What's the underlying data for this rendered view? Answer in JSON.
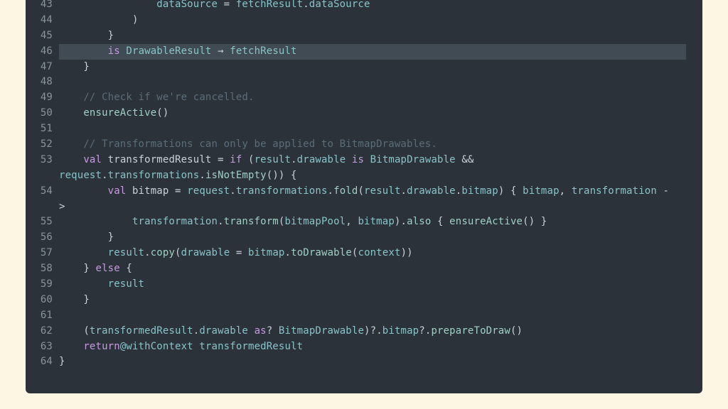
{
  "code_lines": [
    {
      "n": "43",
      "html": "            <span class=\"t\">dataSource</span> = <span class=\"t\">fetchResult</span>.<span class=\"t\">dataSource</span>"
    },
    {
      "n": "44",
      "html": "        )"
    },
    {
      "n": "45",
      "html": "    }"
    },
    {
      "n": "46",
      "html": "    <span class=\"k\">is</span> <span class=\"t\">DrawableResult</span> → <span class=\"t\">fetchResult</span>",
      "highlight": true
    },
    {
      "n": "47",
      "html": "}"
    },
    {
      "n": "48",
      "html": ""
    },
    {
      "n": "49",
      "html": "<span class=\"c\">// Check if we're cancelled.</span>"
    },
    {
      "n": "50",
      "html": "<span class=\"f\">ensureActive</span>()"
    },
    {
      "n": "51",
      "html": ""
    },
    {
      "n": "52",
      "html": "<span class=\"c\">// Transformations can only be applied to BitmapDrawables.</span>"
    },
    {
      "n": "53",
      "html": "<span class=\"k\">val</span> transformedResult = <span class=\"k\">if</span> (<span class=\"t\">result</span>.<span class=\"t\">drawable</span> <span class=\"k\">is</span> <span class=\"t\">BitmapDrawable</span> &amp;&amp;"
    },
    {
      "n": "",
      "html": "<span class=\"t\">request</span>.<span class=\"t\">transformations</span>.<span class=\"f\">isNotEmpty</span>()) {",
      "outdent": true
    },
    {
      "n": "54",
      "html": "    <span class=\"k\">val</span> bitmap = <span class=\"t\">request</span>.<span class=\"t\">transformations</span>.<span class=\"f\">fold</span>(<span class=\"t\">result</span>.<span class=\"t\">drawable</span>.<span class=\"t\">bitmap</span>) { <span class=\"t\">bitmap</span>, <span class=\"t\">transformation</span> -"
    },
    {
      "n": "",
      "html": "&gt;",
      "outdent": true
    },
    {
      "n": "55",
      "html": "        <span class=\"t\">transformation</span>.<span class=\"f\">transform</span>(<span class=\"t\">bitmapPool</span>, <span class=\"t\">bitmap</span>).<span class=\"f\">also</span> { <span class=\"f\">ensureActive</span>() }"
    },
    {
      "n": "56",
      "html": "    }"
    },
    {
      "n": "57",
      "html": "    <span class=\"t\">result</span>.<span class=\"f\">copy</span>(<span class=\"t\">drawable</span> = <span class=\"t\">bitmap</span>.<span class=\"f\">toDrawable</span>(<span class=\"t\">context</span>))"
    },
    {
      "n": "58",
      "html": "} <span class=\"k\">else</span> {"
    },
    {
      "n": "59",
      "html": "    <span class=\"t\">result</span>"
    },
    {
      "n": "60",
      "html": "}"
    },
    {
      "n": "61",
      "html": ""
    },
    {
      "n": "62",
      "html": "(<span class=\"t\">transformedResult</span>.<span class=\"t\">drawable</span> <span class=\"k\">as</span>? <span class=\"t\">BitmapDrawable</span>)?.<span class=\"t\">bitmap</span>?.<span class=\"f\">prepareToDraw</span>()"
    },
    {
      "n": "63",
      "html": "<span class=\"k\">return</span><span class=\"t\">@withContext</span> <span class=\"t\">transformedResult</span>"
    },
    {
      "n": "64",
      "html": "}",
      "outdent": true
    }
  ]
}
